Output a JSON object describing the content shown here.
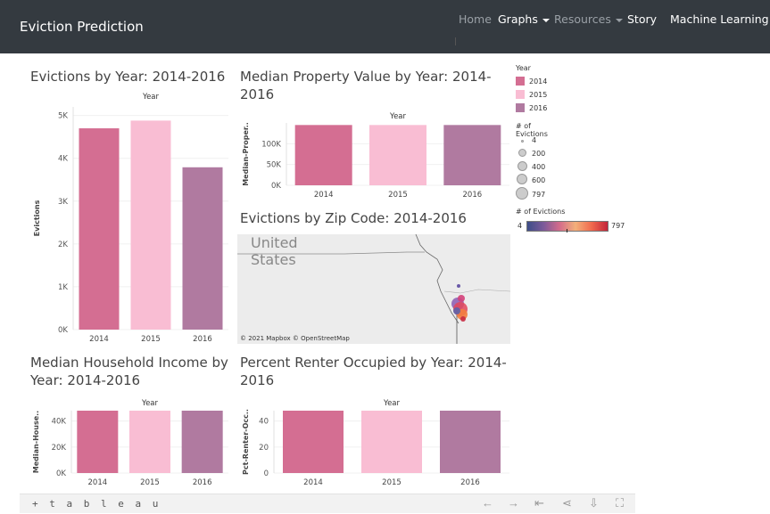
{
  "navbar": {
    "brand": "Eviction Prediction",
    "items": [
      {
        "label": "Home",
        "style": "muted",
        "dropdown": false
      },
      {
        "label": "Graphs",
        "style": "bright",
        "dropdown": true
      },
      {
        "label": "Resources",
        "style": "muted",
        "dropdown": true
      },
      {
        "label": "Story",
        "style": "bright",
        "dropdown": false
      },
      {
        "label": "Machine Learning",
        "style": "bright",
        "dropdown": false
      }
    ]
  },
  "titles": {
    "evictions": "Evictions by Year: 2014-2016",
    "property_line1": "Median Property Value by Year: 2014-",
    "property_line2": "2016",
    "zip": "Evictions by Zip Code: 2014-2016",
    "income_line1": "Median Household Income by",
    "income_line2": "Year: 2014-2016",
    "renter_line1": "Percent Renter Occupied by Year: 2014-",
    "renter_line2": "2016"
  },
  "colors": {
    "2014": "#d46e92",
    "2015": "#f9bdd3",
    "2016": "#b07aa0"
  },
  "map": {
    "country_line1": "United",
    "country_line2": "States",
    "attribution": "© 2021 Mapbox  © OpenStreetMap"
  },
  "legend": {
    "year_title": "Year",
    "years": [
      "2014",
      "2015",
      "2016"
    ],
    "size_title": "# of Evictions",
    "size_values": [
      "4",
      "200",
      "400",
      "600",
      "797"
    ],
    "color_title": "# of Evictions",
    "color_min": "4",
    "color_max": "797"
  },
  "toolbar": {
    "logo": "+ t a b l e a u"
  },
  "chart_data": [
    {
      "id": "evictions",
      "type": "bar",
      "column_header": "Year",
      "categories": [
        "2014",
        "2015",
        "2016"
      ],
      "values": [
        4700,
        4880,
        3790
      ],
      "ylabel": "Evictions",
      "ylim": [
        0,
        5200
      ],
      "yticks": [
        0,
        1000,
        2000,
        3000,
        4000,
        5000
      ],
      "ytick_labels": [
        "0K",
        "1K",
        "2K",
        "3K",
        "4K",
        "5K"
      ]
    },
    {
      "id": "property",
      "type": "bar",
      "column_header": "Year",
      "categories": [
        "2014",
        "2015",
        "2016"
      ],
      "values": [
        145000,
        145000,
        145000
      ],
      "ylabel": "Median-Proper..",
      "ylim": [
        0,
        150000
      ],
      "yticks": [
        0,
        50000,
        100000
      ],
      "ytick_labels": [
        "0K",
        "50K",
        "100K"
      ]
    },
    {
      "id": "income",
      "type": "bar",
      "column_header": "Year",
      "categories": [
        "2014",
        "2015",
        "2016"
      ],
      "values": [
        48000,
        48000,
        48000
      ],
      "ylabel": "Median-House..",
      "ylim": [
        0,
        48000
      ],
      "yticks": [
        0,
        20000,
        40000
      ],
      "ytick_labels": [
        "0K",
        "20K",
        "40K"
      ]
    },
    {
      "id": "renter",
      "type": "bar",
      "column_header": "Year",
      "categories": [
        "2014",
        "2015",
        "2016"
      ],
      "values": [
        48,
        48,
        48
      ],
      "ylabel": "Pct-Renter-Occ..",
      "ylim": [
        0,
        48
      ],
      "yticks": [
        0,
        20,
        40
      ],
      "ytick_labels": [
        "0",
        "20",
        "40"
      ]
    }
  ]
}
